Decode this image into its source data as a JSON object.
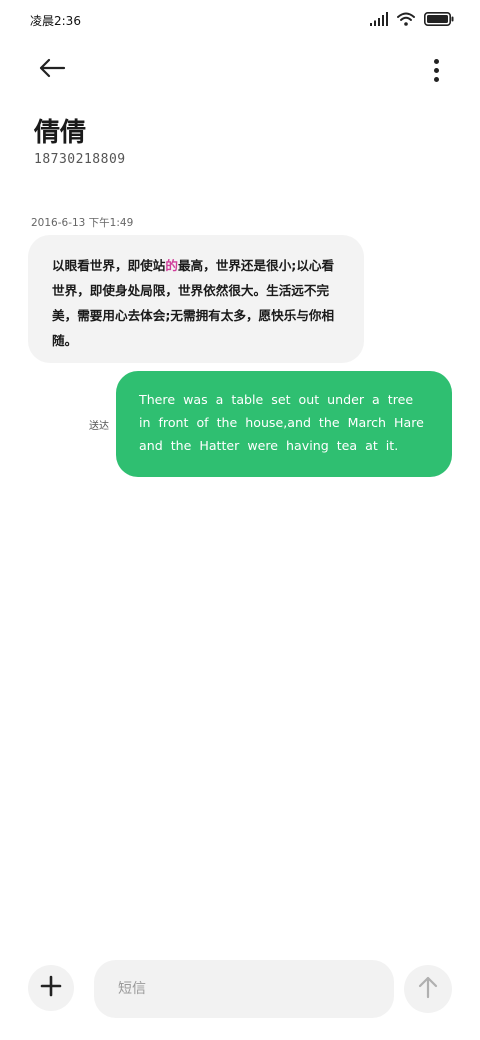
{
  "status_bar": {
    "time": "凌晨2:36",
    "icons": [
      "signal-icon",
      "wifi-icon",
      "battery-icon"
    ]
  },
  "header": {
    "back_icon": "arrow-left-icon",
    "more_icon": "more-vertical-icon",
    "contact_name": "倩倩",
    "contact_number": "18730218809"
  },
  "conversation": {
    "timestamp": "2016-6-13  下午1:49",
    "incoming": {
      "text_before": "以眼看世界，即使站",
      "text_highlight": "的",
      "text_after": "最高，世界还是很小;以心看世界，即使身处局限，世界依然很大。生活远不完美，需要用心去体会;无需拥有太多，愿快乐与你相随。",
      "highlight_color": "#d0409b",
      "bubble_color": "#f3f3f3"
    },
    "outgoing": {
      "status": "送达",
      "text": "There was a table set out under a tree in front of the house,and the March Hare and the Hatter were having tea at it.",
      "bubble_color": "#2fbf71"
    }
  },
  "composer": {
    "add_icon": "plus-icon",
    "placeholder": "短信",
    "value": "",
    "send_icon": "arrow-up-icon"
  }
}
